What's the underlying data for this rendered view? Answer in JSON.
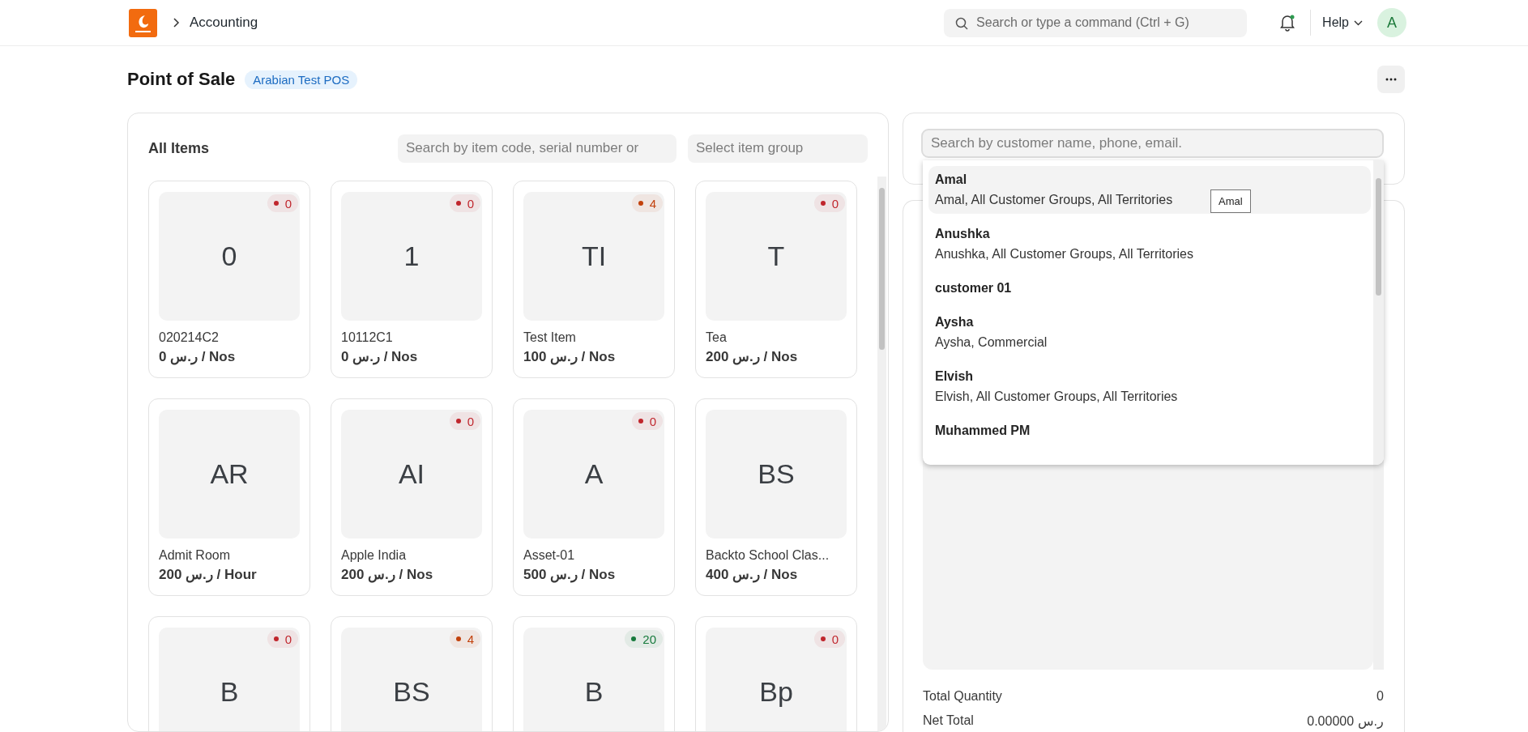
{
  "navbar": {
    "breadcrumb": "Accounting",
    "search": {
      "placeholder": "Search or type a command (Ctrl + G)"
    },
    "help": "Help",
    "avatar": "A"
  },
  "page": {
    "title": "Point of Sale",
    "badge": "Arabian Test POS"
  },
  "items_panel": {
    "title": "All Items",
    "search": {
      "placeholder": "Search by item code, serial number or"
    },
    "group": {
      "placeholder": "Select item group"
    },
    "items": [
      {
        "abbr": "0",
        "name": "020214C2",
        "price": "ر.س 0 / Nos",
        "stock": "0",
        "color": "#c0262d"
      },
      {
        "abbr": "1",
        "name": "10112C1",
        "price": "ر.س 0 / Nos",
        "stock": "0",
        "color": "#c0262d"
      },
      {
        "abbr": "TI",
        "name": "Test Item",
        "price": "ر.س 100 / Nos",
        "stock": "4",
        "color": "#c2410c"
      },
      {
        "abbr": "T",
        "name": "Tea",
        "price": "ر.س 200 / Nos",
        "stock": "0",
        "color": "#c0262d"
      },
      {
        "abbr": "AR",
        "name": "Admit Room",
        "price": "ر.س 200 / Hour"
      },
      {
        "abbr": "AI",
        "name": "Apple India",
        "price": "ر.س 200 / Nos",
        "stock": "0",
        "color": "#c0262d"
      },
      {
        "abbr": "A",
        "name": "Asset-01",
        "price": "ر.س 500 / Nos",
        "stock": "0",
        "color": "#c0262d"
      },
      {
        "abbr": "BS",
        "name": "Backto School Clas...",
        "price": "ر.س 400 / Nos"
      },
      {
        "abbr": "B",
        "stock": "0",
        "color": "#c0262d"
      },
      {
        "abbr": "BS",
        "stock": "4",
        "color": "#c2410c"
      },
      {
        "abbr": "B",
        "stock": "20",
        "color": "#167a3c"
      },
      {
        "abbr": "Bp",
        "stock": "0",
        "color": "#c0262d"
      }
    ]
  },
  "customer": {
    "search": {
      "placeholder": "Search by customer name, phone, email."
    },
    "suggestions": [
      {
        "name": "Amal",
        "detail": "Amal, All Customer Groups, All Territories",
        "selected": true
      },
      {
        "name": "Anushka",
        "detail": "Anushka, All Customer Groups, All Territories",
        "selected": false
      },
      {
        "name": "customer 01",
        "selected": false
      },
      {
        "name": "Aysha",
        "detail": "Aysha, Commercial",
        "selected": false
      },
      {
        "name": "Elvish",
        "detail": "Elvish, All Customer Groups, All Territories",
        "selected": false
      },
      {
        "name": "Muhammed PM",
        "selected": false
      }
    ],
    "tooltip": "Amal"
  },
  "totals": [
    {
      "label": "Total Quantity",
      "value": "0"
    },
    {
      "label": "Net Total",
      "value": "ر.س 0.00000"
    }
  ]
}
